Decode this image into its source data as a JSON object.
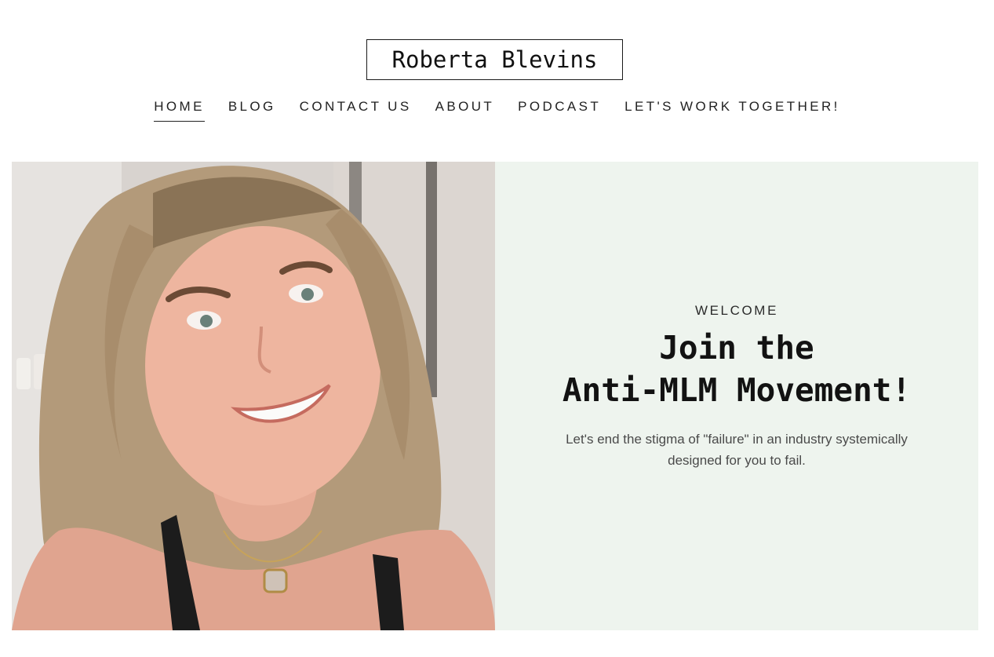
{
  "site": {
    "logo_text": "Roberta Blevins"
  },
  "nav": {
    "items": [
      {
        "label": "HOME",
        "active": true
      },
      {
        "label": "BLOG",
        "active": false
      },
      {
        "label": "CONTACT US",
        "active": false
      },
      {
        "label": "ABOUT",
        "active": false
      },
      {
        "label": "PODCAST",
        "active": false
      },
      {
        "label": "LET'S WORK TOGETHER!",
        "active": false
      }
    ]
  },
  "hero": {
    "eyebrow": "WELCOME",
    "headline_line1": "Join the",
    "headline_line2": "Anti-MLM Movement!",
    "subtext": "Let's end the stigma of \"failure\" in an industry systemically designed for you to fail.",
    "panel_color": "#eef4ee"
  }
}
